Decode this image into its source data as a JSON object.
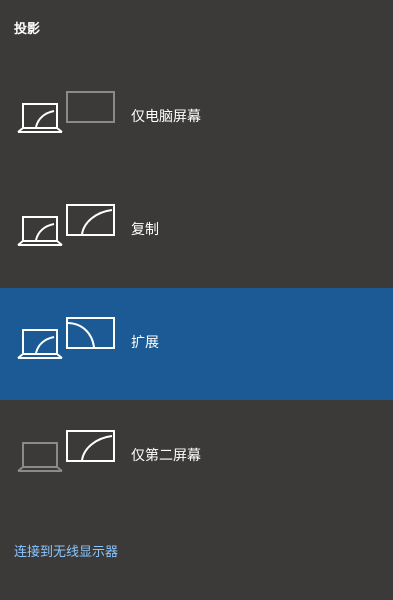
{
  "panel": {
    "title": "投影",
    "options": [
      {
        "label": "仅电脑屏幕",
        "icon": "pc-screen-only-icon",
        "selected": false
      },
      {
        "label": "复制",
        "icon": "duplicate-icon",
        "selected": false
      },
      {
        "label": "扩展",
        "icon": "extend-icon",
        "selected": true
      },
      {
        "label": "仅第二屏幕",
        "icon": "second-screen-only-icon",
        "selected": false
      }
    ],
    "connect_link": "连接到无线显示器"
  },
  "colors": {
    "background": "#3b3a39",
    "selected": "#1c5a96",
    "link": "#8cc6ff",
    "icon_active": "#ffffff",
    "icon_inactive": "#8a8a8a"
  }
}
